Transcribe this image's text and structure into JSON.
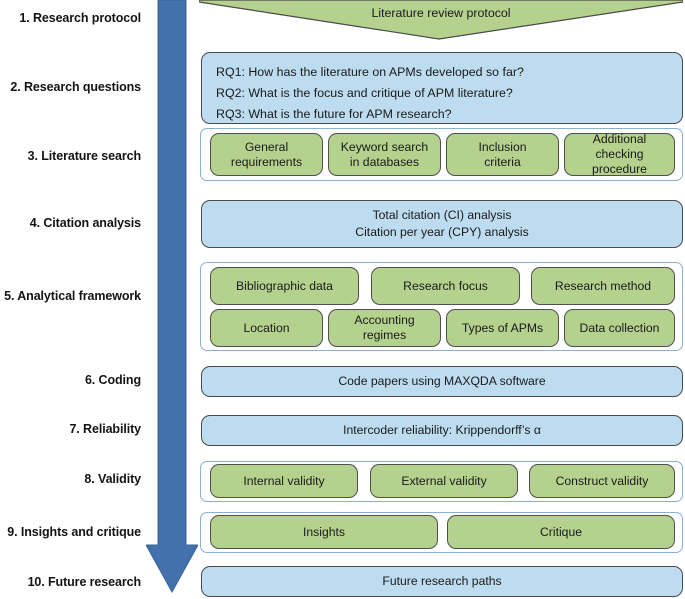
{
  "diagram": {
    "title": "Literature review protocol flow diagram",
    "colors": {
      "green_fill": "#b4d28e",
      "blue_fill": "#bddcf0",
      "arrow_blue": "#4271ad",
      "box_border": "#4a4a4a",
      "bracket_blue": "#8ab0d6"
    },
    "arrow": {
      "name": "downward-process-arrow",
      "direction": "down"
    }
  },
  "stages": [
    {
      "num": "1.",
      "label": "1. Research protocol"
    },
    {
      "num": "2.",
      "label": "2. Research questions"
    },
    {
      "num": "3.",
      "label": "3. Literature search"
    },
    {
      "num": "4.",
      "label": "4. Citation analysis"
    },
    {
      "num": "5.",
      "label": "5. Analytical framework"
    },
    {
      "num": "6.",
      "label": "6. Coding"
    },
    {
      "num": "7.",
      "label": "7. Reliability"
    },
    {
      "num": "8.",
      "label": "8. Validity"
    },
    {
      "num": "9.",
      "label": "9. Insights and critique"
    },
    {
      "num": "10.",
      "label": "10. Future research"
    }
  ],
  "protocol": {
    "label": "Literature review protocol"
  },
  "research_questions": {
    "rq1": "RQ1: How has the literature on APMs developed so far?",
    "rq2": "RQ2: What is the focus and critique of APM literature?",
    "rq3": "RQ3: What is the future for APM research?"
  },
  "literature_search": {
    "items": [
      "General\nrequirements",
      "Keyword search\nin databases",
      "Inclusion\ncriteria",
      "Additional\nchecking\nprocedure"
    ]
  },
  "citation_analysis": {
    "line1": "Total citation (CI) analysis",
    "line2": "Citation per year (CPY) analysis"
  },
  "analytical_framework": {
    "row1": [
      "Bibliographic data",
      "Research focus",
      "Research method"
    ],
    "row2": [
      "Location",
      "Accounting\nregimes",
      "Types of APMs",
      "Data collection"
    ]
  },
  "coding": {
    "label": "Code papers using MAXQDA software"
  },
  "reliability": {
    "label": "Intercoder reliability: Krippendorff’s α"
  },
  "validity": {
    "items": [
      "Internal validity",
      "External validity",
      "Construct validity"
    ]
  },
  "insights_and_critique": {
    "items": [
      "Insights",
      "Critique"
    ]
  },
  "future_research": {
    "label": "Future research paths"
  }
}
